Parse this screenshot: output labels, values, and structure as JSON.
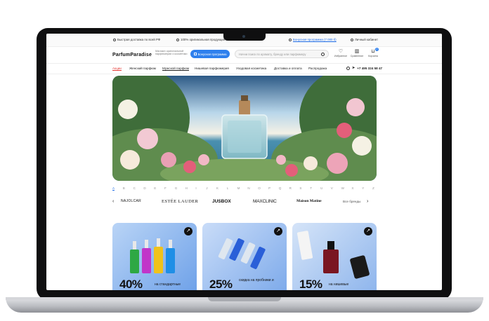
{
  "topbar": {
    "delivery": "Быстрая доставка по всей РФ",
    "original": "100% оригинальная продукция",
    "bonus": "Бонусная программа (7 000 б)",
    "account": "Личный кабинет"
  },
  "header": {
    "logo": "ParfumParadise",
    "tagline": "Магазин оригинальной парфюмерии и косметики",
    "promo_button": "Бонусная программа",
    "search_placeholder": "Начни поиск по аромату, бренду или парфюмеру",
    "favorites": "Избранное",
    "compare": "Сравнение",
    "cart": "Корзина",
    "cart_count": "2"
  },
  "nav": {
    "items": [
      "Акции",
      "Женский парфюм",
      "Мужской парфюм",
      "Нишевая парфюмерия",
      "Уходовая косметика",
      "Доставка и оплата",
      "Распродажа"
    ],
    "phone": "+7 495 324 58 47"
  },
  "alphabet": [
    "A",
    "B",
    "C",
    "D",
    "E",
    "F",
    "G",
    "H",
    "I",
    "J",
    "K",
    "L",
    "M",
    "N",
    "O",
    "P",
    "Q",
    "R",
    "S",
    "T",
    "U",
    "V",
    "W",
    "X",
    "Y",
    "Z"
  ],
  "brands": {
    "list": [
      "NAJOLCAR",
      "ESTÉE LAUDER",
      "JUSBOX",
      "MAXCLINIC",
      "Maison Matine"
    ],
    "all_brands": "Все бренды"
  },
  "promo_cards": [
    {
      "big": "40%",
      "small": "на стандартные"
    },
    {
      "big": "25%",
      "small": "скидка на пробники и"
    },
    {
      "big": "15%",
      "small": "на нишевые"
    }
  ],
  "colors": {
    "accent": "#2f80ed",
    "sale": "#e53935"
  }
}
